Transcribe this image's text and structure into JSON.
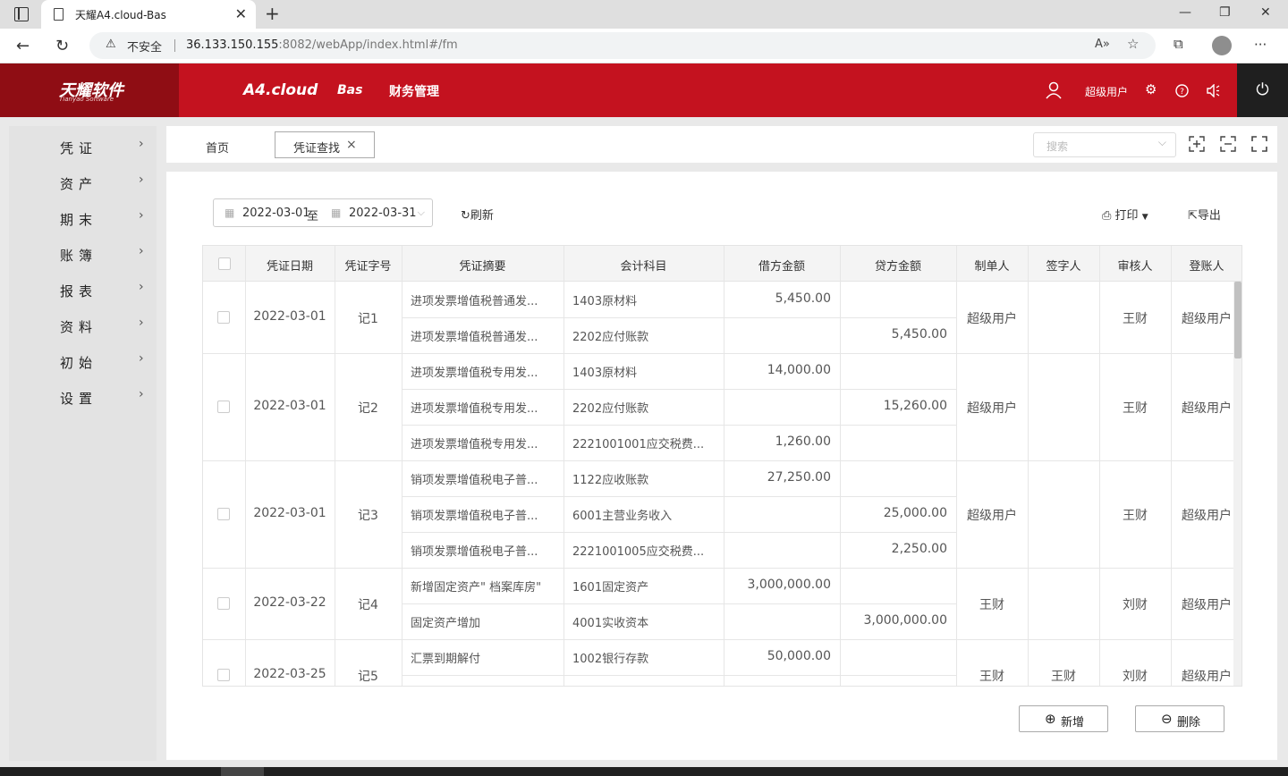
{
  "browser": {
    "tab_title": "天耀A4.cloud-Bas",
    "close_glyph": "✕",
    "new_tab_glyph": "+",
    "minimize_glyph": "—",
    "restore_glyph": "❐",
    "close_window_glyph": "✕",
    "back_glyph": "←",
    "reload_glyph": "↻",
    "not_secure": "不安全",
    "url_host": "36.133.150.155",
    "url_rest": ":8082/webApp/index.html#/fm",
    "read_aloud_glyph": "A»",
    "favorite_glyph": "☆",
    "collections_glyph": "⧉",
    "more_glyph": "···"
  },
  "header": {
    "logo_cn": "天耀软件",
    "logo_en": "Tianyao Software",
    "product": "A4.cloud",
    "module": "Bas",
    "section": "财务管理",
    "user_name": "超级用户",
    "power_glyph": "⏻"
  },
  "sidebar": {
    "items": [
      {
        "label": "凭证"
      },
      {
        "label": "资产"
      },
      {
        "label": "期末"
      },
      {
        "label": "账簿"
      },
      {
        "label": "报表"
      },
      {
        "label": "资料"
      },
      {
        "label": "初始"
      },
      {
        "label": "设置"
      }
    ],
    "chevron": "›"
  },
  "tabs": {
    "home": "首页",
    "active": "凭证查找",
    "close": "×",
    "search_placeholder": "搜索"
  },
  "toolbar": {
    "date_start": "2022-03-01",
    "date_sep": "至",
    "date_end": "2022-03-31",
    "refresh": "刷新",
    "print": "打印",
    "export": "导出"
  },
  "table": {
    "headers": [
      "凭证日期",
      "凭证字号",
      "凭证摘要",
      "会计科目",
      "借方金额",
      "贷方金额",
      "制单人",
      "签字人",
      "审核人",
      "登账人"
    ],
    "vouchers": [
      {
        "date": "2022-03-01",
        "no": "记1",
        "maker": "超级用户",
        "signer": "",
        "auditor": "王财",
        "poster": "超级用户",
        "lines": [
          {
            "summary": "进项发票增值税普通发...",
            "account": "1403原材料",
            "debit": "5,450.00",
            "credit": ""
          },
          {
            "summary": "进项发票增值税普通发...",
            "account": "2202应付账款",
            "debit": "",
            "credit": "5,450.00"
          }
        ]
      },
      {
        "date": "2022-03-01",
        "no": "记2",
        "maker": "超级用户",
        "signer": "",
        "auditor": "王财",
        "poster": "超级用户",
        "lines": [
          {
            "summary": "进项发票增值税专用发...",
            "account": "1403原材料",
            "debit": "14,000.00",
            "credit": ""
          },
          {
            "summary": "进项发票增值税专用发...",
            "account": "2202应付账款",
            "debit": "",
            "credit": "15,260.00"
          },
          {
            "summary": "进项发票增值税专用发...",
            "account": "2221001001应交税费...",
            "debit": "1,260.00",
            "credit": ""
          }
        ]
      },
      {
        "date": "2022-03-01",
        "no": "记3",
        "maker": "超级用户",
        "signer": "",
        "auditor": "王财",
        "poster": "超级用户",
        "lines": [
          {
            "summary": "销项发票增值税电子普...",
            "account": "1122应收账款",
            "debit": "27,250.00",
            "credit": ""
          },
          {
            "summary": "销项发票增值税电子普...",
            "account": "6001主营业务收入",
            "debit": "",
            "credit": "25,000.00"
          },
          {
            "summary": "销项发票增值税电子普...",
            "account": "2221001005应交税费...",
            "debit": "",
            "credit": "2,250.00"
          }
        ]
      },
      {
        "date": "2022-03-22",
        "no": "记4",
        "maker": "王财",
        "signer": "",
        "auditor": "刘财",
        "poster": "超级用户",
        "lines": [
          {
            "summary": "新增固定资产\" 档案库房\"",
            "account": "1601固定资产",
            "debit": "3,000,000.00",
            "credit": ""
          },
          {
            "summary": "固定资产增加",
            "account": "4001实收资本",
            "debit": "",
            "credit": "3,000,000.00"
          }
        ]
      },
      {
        "date": "2022-03-25",
        "no": "记5",
        "maker": "王财",
        "signer": "王财",
        "auditor": "刘财",
        "poster": "超级用户",
        "lines": [
          {
            "summary": "汇票到期解付",
            "account": "1002银行存款",
            "debit": "50,000.00",
            "credit": ""
          },
          {
            "summary": "",
            "account": "",
            "debit": "",
            "credit": ""
          }
        ]
      }
    ]
  },
  "buttons": {
    "add": "新增",
    "delete": "删除"
  }
}
